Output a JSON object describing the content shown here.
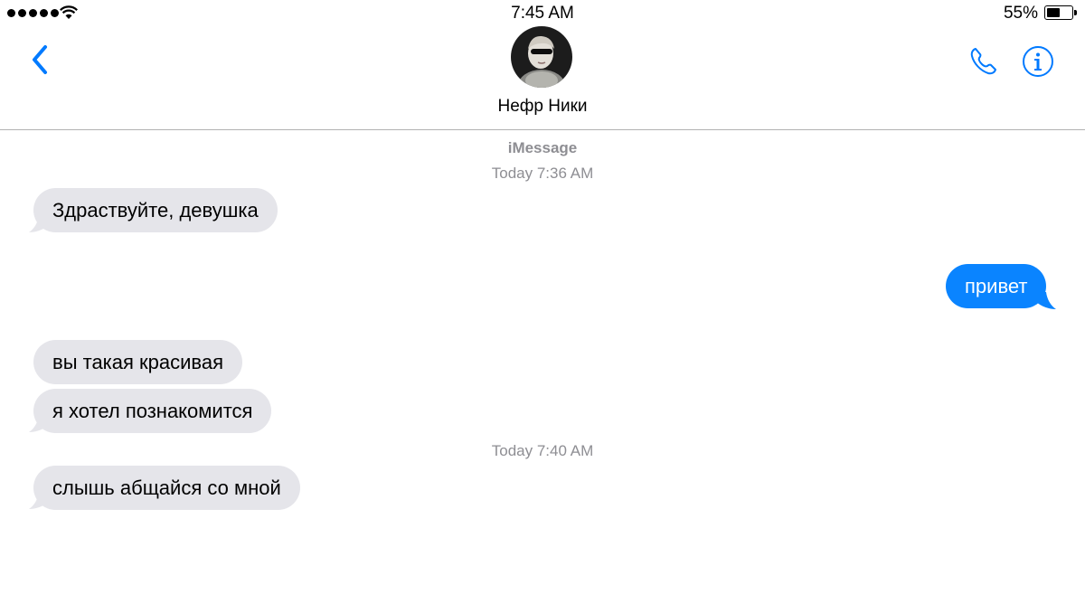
{
  "status_bar": {
    "time": "7:45 AM",
    "battery_percent": "55%",
    "battery_level": 0.55,
    "signal_bars": 5
  },
  "header": {
    "contact_name": "Нефр Ники",
    "back_icon": "chevron-left-icon",
    "call_icon": "phone-icon",
    "info_icon": "info-icon"
  },
  "conversation": {
    "service_label": "iMessage",
    "timestamps": [
      "Today 7:36 AM",
      "Today 7:40 AM"
    ],
    "messages": [
      {
        "direction": "incoming",
        "text": "Здраствуйте, девушка"
      },
      {
        "direction": "outgoing",
        "text": "привет"
      },
      {
        "direction": "incoming",
        "text": "вы такая красивая"
      },
      {
        "direction": "incoming",
        "text": "я хотел познакомится"
      },
      {
        "direction": "incoming",
        "text": "слышь абщайся со мной"
      }
    ]
  },
  "colors": {
    "accent": "#007aff",
    "incoming_bubble": "#e5e5ea",
    "outgoing_bubble": "#0a84ff",
    "secondary_text": "#8e8e93"
  }
}
